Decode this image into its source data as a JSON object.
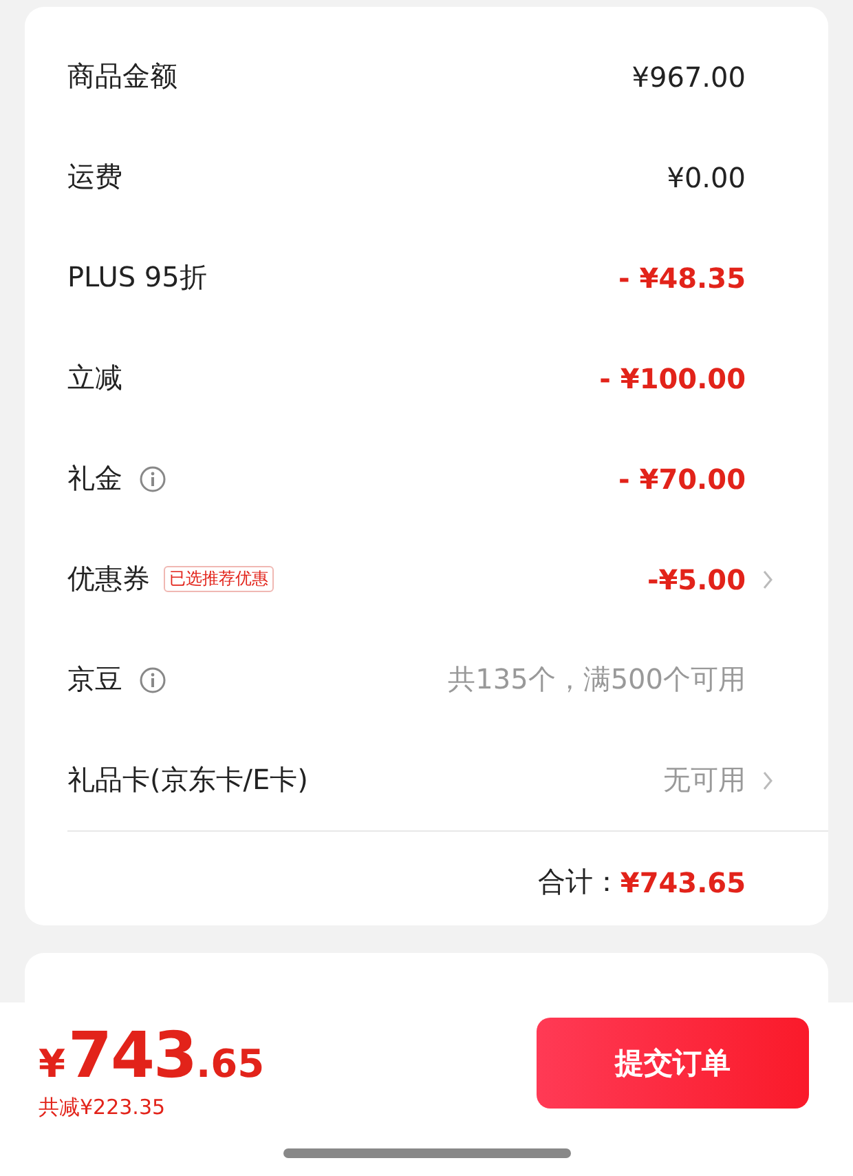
{
  "summary": {
    "rows": [
      {
        "label": "商品金额",
        "info": false,
        "value": "¥967.00",
        "kind": "plain",
        "chevron": false
      },
      {
        "label": "运费",
        "info": false,
        "value": "¥0.00",
        "kind": "plain",
        "chevron": false
      },
      {
        "label": "PLUS 95折",
        "info": false,
        "value": "- ¥48.35",
        "kind": "discount",
        "chevron": false
      },
      {
        "label": "立减",
        "info": false,
        "value": "- ¥100.00",
        "kind": "discount",
        "chevron": false
      },
      {
        "label": "礼金",
        "info": true,
        "value": "- ¥70.00",
        "kind": "discount",
        "chevron": false
      },
      {
        "label": "优惠券",
        "info": false,
        "tag": "已选推荐优惠",
        "value": "-¥5.00",
        "kind": "discount",
        "chevron": true
      },
      {
        "label": "京豆",
        "info": true,
        "value": "共135个，满500个可用",
        "kind": "muted",
        "chevron": false
      },
      {
        "label": "礼品卡(京东卡/E卡)",
        "info": false,
        "value": "无可用",
        "kind": "muted",
        "chevron": true
      }
    ],
    "total_label": "合计：",
    "total_value": "¥743.65"
  },
  "bottom_bar": {
    "currency": "¥",
    "amount_integer": "743",
    "amount_decimal": ".65",
    "saved": "共减¥223.35",
    "submit": "提交订单"
  }
}
